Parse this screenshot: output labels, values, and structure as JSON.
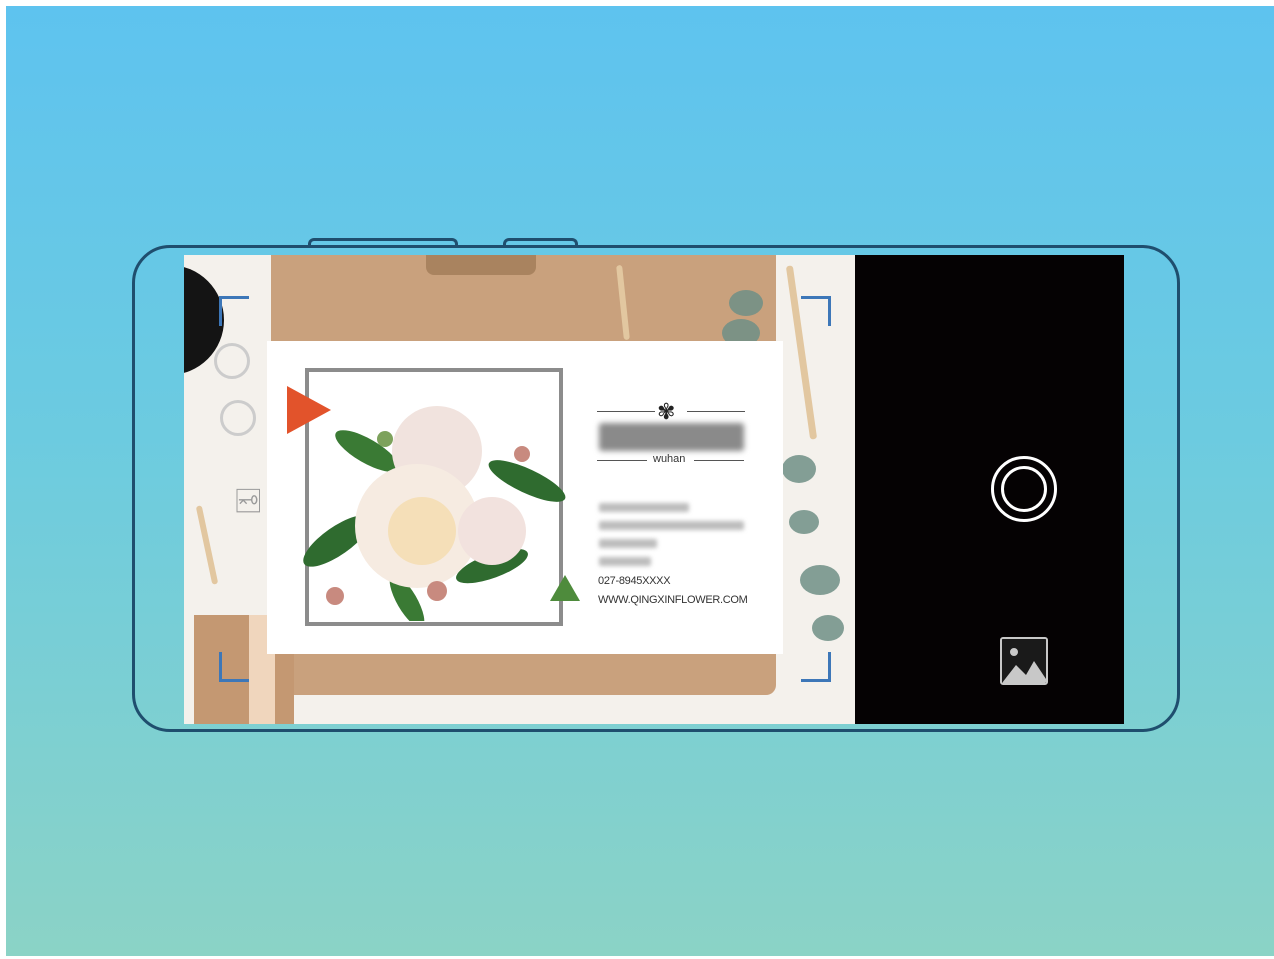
{
  "card": {
    "brand": "wuhan",
    "phone": "027-8945XXXX",
    "website": "WWW.QINGXINFLOWER.COM"
  },
  "icons": {
    "shutter": "shutter-button-icon",
    "gallery": "gallery-image-icon",
    "logo": "flower-logo-icon"
  },
  "colors": {
    "frame_corners": "#3d77b8",
    "controls_bg": "#050203",
    "phone_outline": "#1f4e6e",
    "accent_red": "#e2532b",
    "accent_green": "#4e8b3c"
  }
}
